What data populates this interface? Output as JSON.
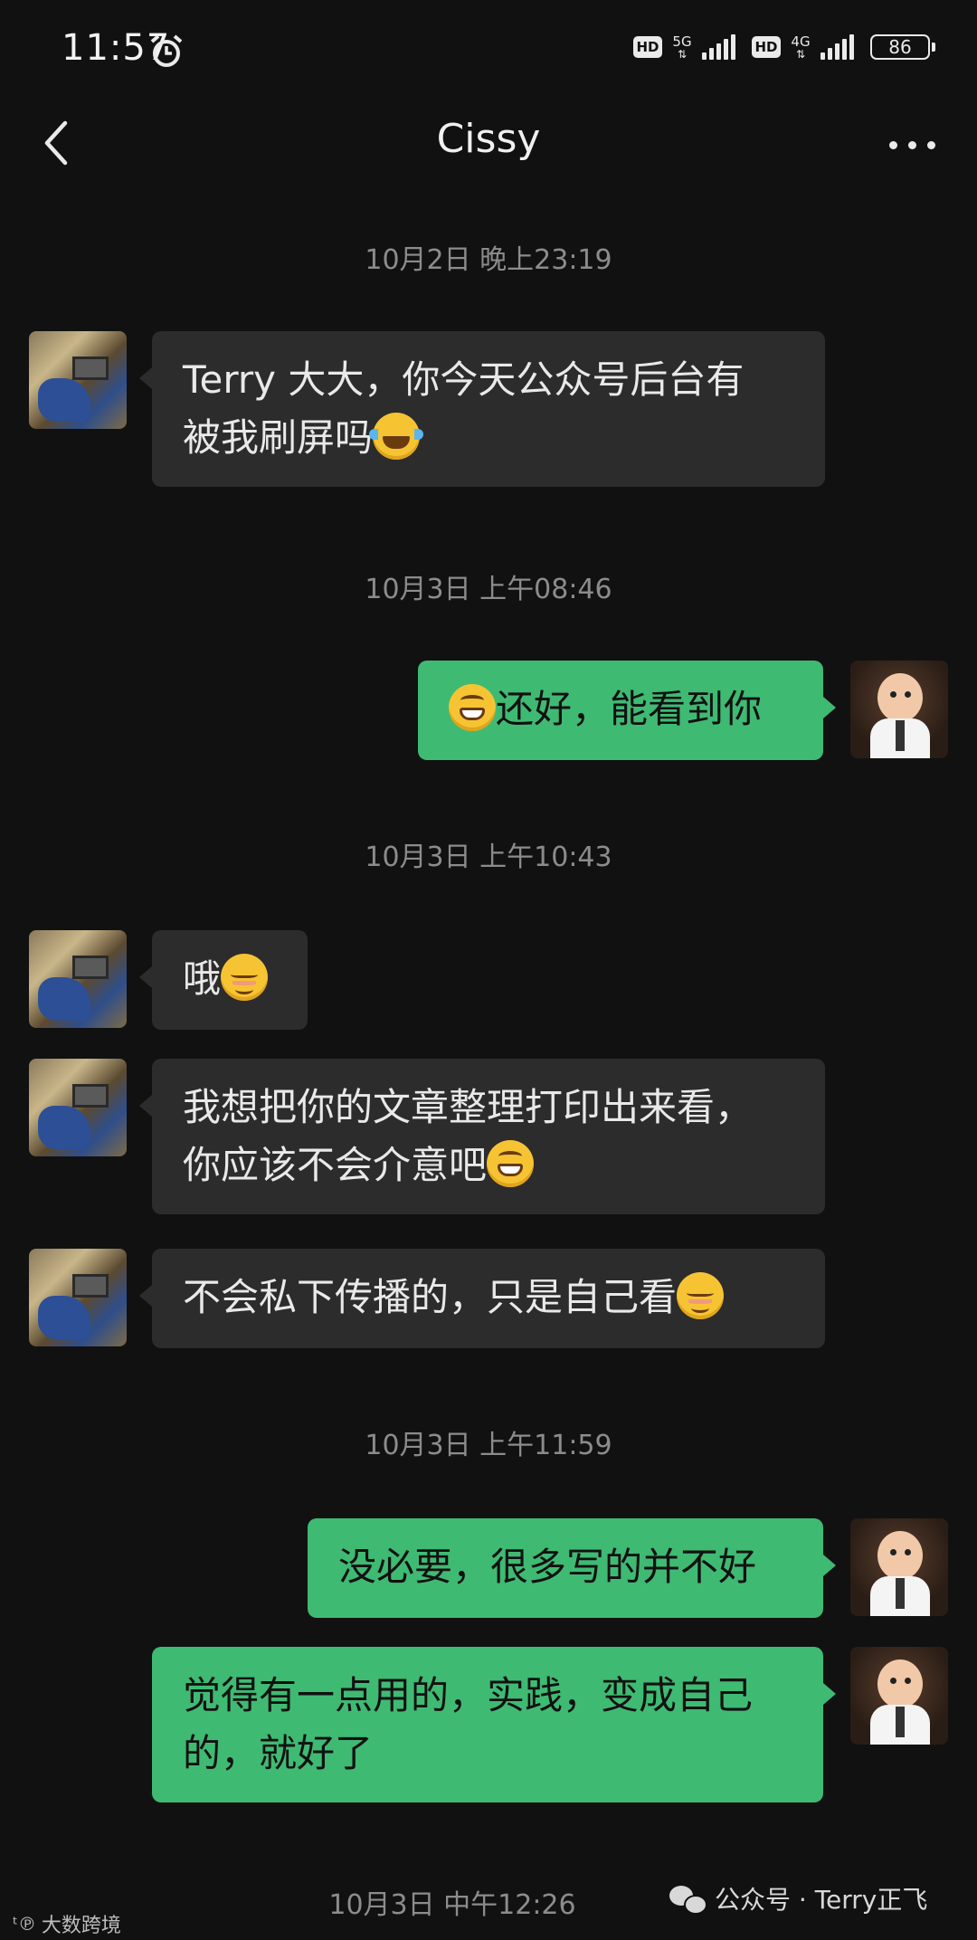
{
  "status_bar": {
    "time": "11:57",
    "hd1": "HD",
    "net1": "5G",
    "hd2": "HD",
    "net2": "4G",
    "battery": "86"
  },
  "nav": {
    "title": "Cissy"
  },
  "timestamps": [
    "10月2日 晚上23:19",
    "10月3日 上午08:46",
    "10月3日 上午10:43",
    "10月3日 上午11:59",
    "10月3日 中午12:26"
  ],
  "messages": [
    {
      "line1": "Terry 大大，你今天公众号后台有",
      "line2": "被我刷屏吗"
    },
    {
      "text": "还好，能看到你"
    },
    {
      "text": "哦"
    },
    {
      "line1": "我想把你的文章整理打印出来看，",
      "line2": "你应该不会介意吧"
    },
    {
      "text": "不会私下传播的，只是自己看"
    },
    {
      "text": "没必要，很多写的并不好"
    },
    {
      "line1": "觉得有一点用的，实践，变成自己",
      "line2": "的，就好了"
    }
  ],
  "watermark": {
    "text": "公众号 · Terry正飞"
  },
  "corner_logo": {
    "text": "大数跨境"
  },
  "colors": {
    "outgoing_bubble": "#3fba73",
    "incoming_bubble": "#2c2c2c",
    "background": "#111111"
  }
}
